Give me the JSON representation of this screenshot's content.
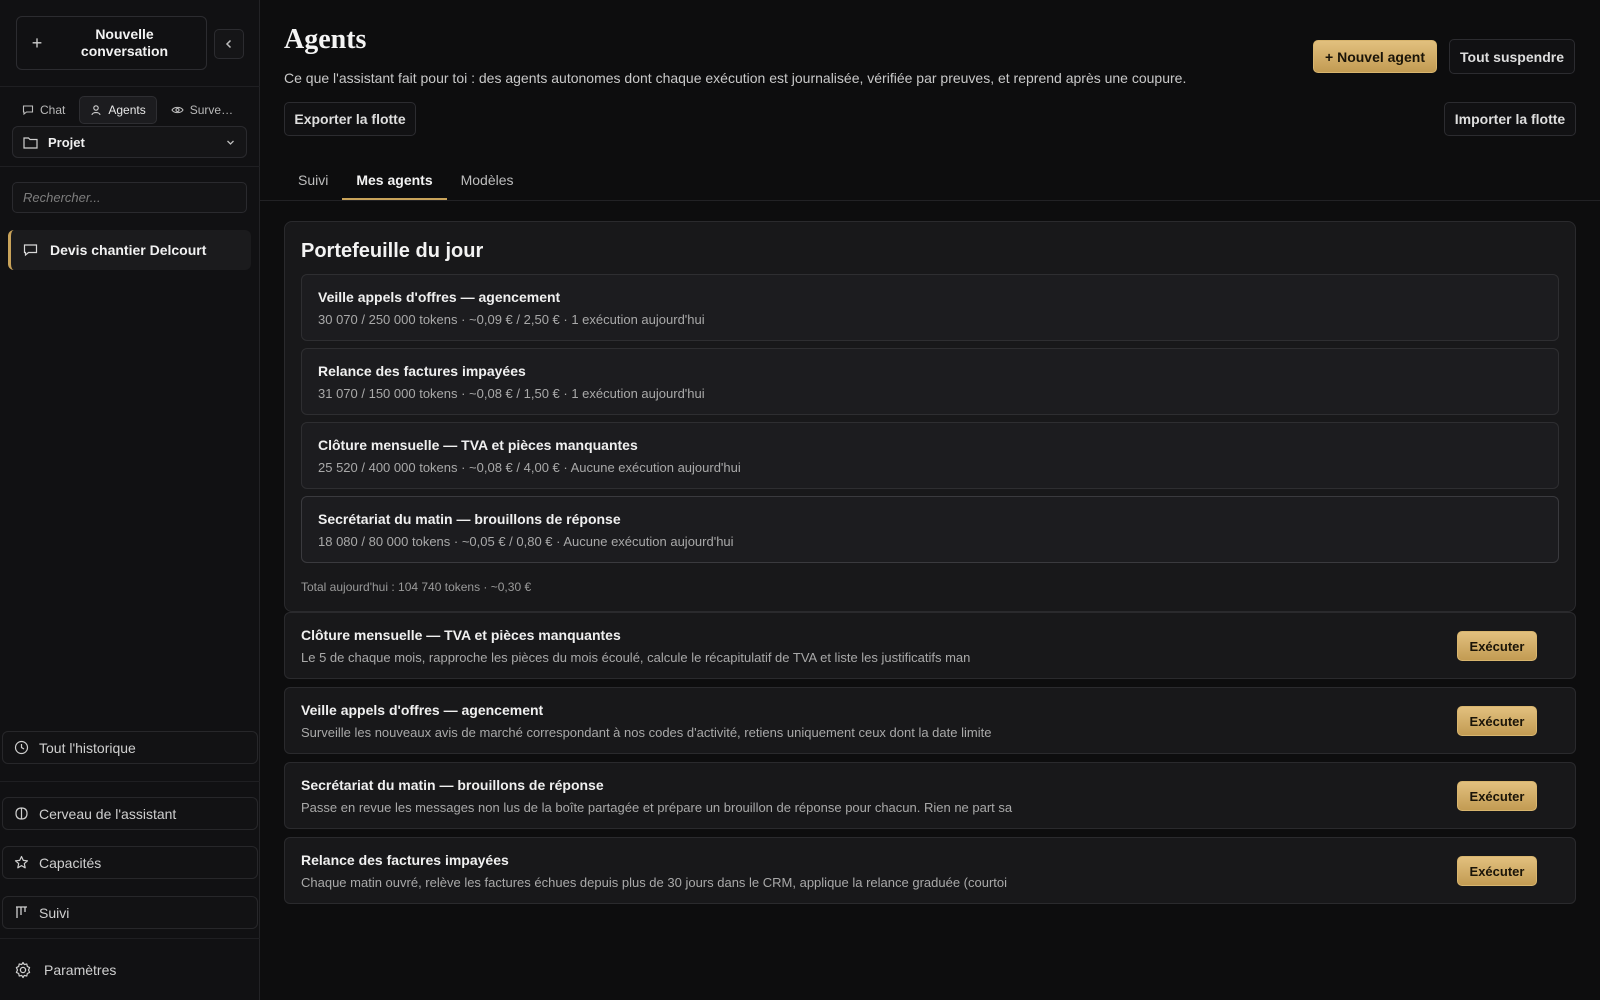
{
  "sidebar": {
    "new_conversation_label": "Nouvelle conversation",
    "modes": [
      {
        "label": "Chat",
        "icon": "chat-icon"
      },
      {
        "label": "Agents",
        "icon": "user-icon"
      },
      {
        "label": "Surve…",
        "icon": "eye-icon"
      }
    ],
    "project_label": "Projet",
    "search_placeholder": "Rechercher...",
    "conversations": [
      {
        "label": "Devis chantier Delcourt"
      }
    ],
    "all_history_label": "Tout l'historique",
    "brain_label": "Cerveau de l'assistant",
    "capabilities_label": "Capacités",
    "tracking_label": "Suivi",
    "settings_label": "Paramètres"
  },
  "header": {
    "title": "Agents",
    "subtitle": "Ce que l'assistant fait pour toi : des agents autonomes dont chaque exécution est journalisée, vérifiée par preuves, et reprend après une coupure.",
    "new_agent_label": "+ Nouvel agent",
    "suspend_all_label": "Tout suspendre",
    "export_label": "Exporter la flotte",
    "import_label": "Importer la flotte"
  },
  "tabs": [
    {
      "label": "Suivi",
      "active": false
    },
    {
      "label": "Mes agents",
      "active": true
    },
    {
      "label": "Modèles",
      "active": false
    }
  ],
  "portfolio": {
    "title": "Portefeuille du jour",
    "items": [
      {
        "title": "Veille appels d'offres — agencement",
        "meta": "30 070 / 250 000 tokens · ~0,09 € / 2,50 € · 1 exécution aujourd'hui"
      },
      {
        "title": "Relance des factures impayées",
        "meta": "31 070 / 150 000 tokens · ~0,08 € / 1,50 € · 1 exécution aujourd'hui"
      },
      {
        "title": "Clôture mensuelle — TVA et pièces manquantes",
        "meta": "25 520 / 400 000 tokens · ~0,08 € / 4,00 € · Aucune exécution aujourd'hui"
      },
      {
        "title": "Secrétariat du matin — brouillons de réponse",
        "meta": "18 080 / 80 000 tokens · ~0,05 € / 0,80 € · Aucune exécution aujourd'hui"
      }
    ],
    "total": "Total aujourd'hui : 104 740 tokens · ~0,30 €"
  },
  "agents": [
    {
      "title": "Clôture mensuelle — TVA et pièces manquantes",
      "description": "Le 5 de chaque mois, rapproche les pièces du mois écoulé, calcule le récapitulatif de TVA et liste les justificatifs man",
      "run_label": "Exécuter"
    },
    {
      "title": "Veille appels d'offres — agencement",
      "description": "Surveille les nouveaux avis de marché correspondant à nos codes d'activité, retiens uniquement ceux dont la date limite",
      "run_label": "Exécuter"
    },
    {
      "title": "Secrétariat du matin — brouillons de réponse",
      "description": "Passe en revue les messages non lus de la boîte partagée et prépare un brouillon de réponse pour chacun. Rien ne part sa",
      "run_label": "Exécuter"
    },
    {
      "title": "Relance des factures impayées",
      "description": "Chaque matin ouvré, relève les factures échues depuis plus de 30 jours dans le CRM, applique la relance graduée (courtoi",
      "run_label": "Exécuter"
    }
  ],
  "colors": {
    "accent": "#c9a35a",
    "background": "#0d0d0e",
    "sidebar": "#111113",
    "card": "#18181a"
  }
}
